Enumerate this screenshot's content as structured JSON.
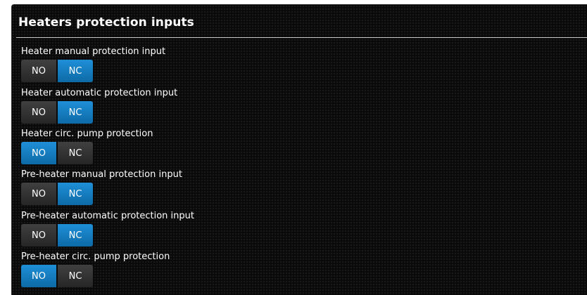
{
  "panel": {
    "title": "Heaters protection inputs"
  },
  "colors": {
    "selected": "#1a7fc0",
    "unselected": "#353535",
    "background": "#0a0a0a",
    "text": "#ffffff"
  },
  "settings": [
    {
      "label": "Heater manual protection input",
      "options": [
        "NO",
        "NC"
      ],
      "selected": "NC"
    },
    {
      "label": "Heater automatic protection input",
      "options": [
        "NO",
        "NC"
      ],
      "selected": "NC"
    },
    {
      "label": "Heater circ. pump protection",
      "options": [
        "NO",
        "NC"
      ],
      "selected": "NO"
    },
    {
      "label": "Pre-heater manual protection input",
      "options": [
        "NO",
        "NC"
      ],
      "selected": "NC"
    },
    {
      "label": "Pre-heater automatic protection input",
      "options": [
        "NO",
        "NC"
      ],
      "selected": "NC"
    },
    {
      "label": "Pre-heater circ. pump protection",
      "options": [
        "NO",
        "NC"
      ],
      "selected": "NO"
    }
  ]
}
